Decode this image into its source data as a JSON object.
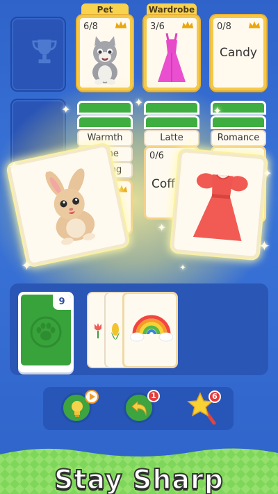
{
  "foundations": [
    {
      "tag": "",
      "count": "",
      "content": "trophy"
    },
    {
      "tag": "Pet",
      "count": "6/8",
      "content": "cat"
    },
    {
      "tag": "Wardrobe",
      "count": "3/6",
      "content": "dress"
    },
    {
      "tag": "",
      "count": "0/8",
      "content": "Candy"
    }
  ],
  "tableau": {
    "col2": [
      "Warmth",
      "Flame",
      "Shining"
    ],
    "col2_partial": "h",
    "col3_word": "Latte",
    "col3_card": {
      "count": "0/6",
      "word": "Coff"
    },
    "col4_word": "Romance"
  },
  "flying_cards": [
    "bunny",
    "red-dress"
  ],
  "stock": {
    "count": "9"
  },
  "waste_cards": [
    "tulip",
    "corn",
    "rainbow"
  ],
  "tools": {
    "hint_badge": "",
    "undo_badge": "1",
    "magic_badge": "6"
  },
  "headline": "Stay Sharp",
  "colors": {
    "background": "#2f63c9",
    "card_border_gold": "#f4c94b",
    "card_back_green": "#3fae40",
    "badge_red": "#e53b3b"
  }
}
